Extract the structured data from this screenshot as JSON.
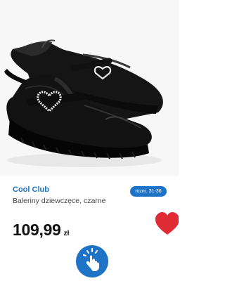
{
  "product": {
    "image_alt": "Baleriny dziewczęce, czarne",
    "brand": "Cool Club",
    "size_badge": "rozm. 31-36",
    "name": "Baleriny dziewczęce, czarne",
    "price": {
      "amount": "109,99",
      "currency": "zł"
    }
  },
  "icons": {
    "wishlist": "heart-icon",
    "tap": "tap-hand-icon"
  },
  "colors": {
    "brand": "#1f73c7",
    "badge_bg": "#1f73c7",
    "price": "#111111",
    "heart": "#e02b35",
    "tap_button": "#1f73c7"
  }
}
